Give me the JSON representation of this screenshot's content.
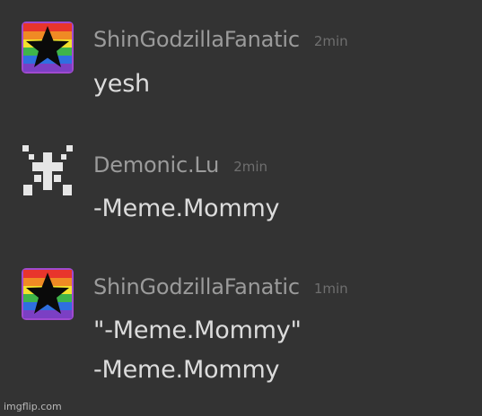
{
  "messages": [
    {
      "username": "ShinGodzillaFanatic",
      "time": "2min",
      "avatar_icon": "rainbow-star-icon",
      "lines": [
        "yesh"
      ]
    },
    {
      "username": "Demonic.Lu",
      "time": "2min",
      "avatar_icon": "pixel-cross-icon",
      "lines": [
        "-Meme.Mommy"
      ]
    },
    {
      "username": "ShinGodzillaFanatic",
      "time": "1min",
      "avatar_icon": "rainbow-star-icon",
      "lines": [
        "\"-Meme.Mommy\"",
        "-Meme.Mommy"
      ]
    }
  ],
  "watermark": "imgflip.com",
  "colors": {
    "background": "#333333",
    "username": "#9b9b9b",
    "timestamp": "#6f6f6f",
    "message_text": "#dcdcdc"
  }
}
